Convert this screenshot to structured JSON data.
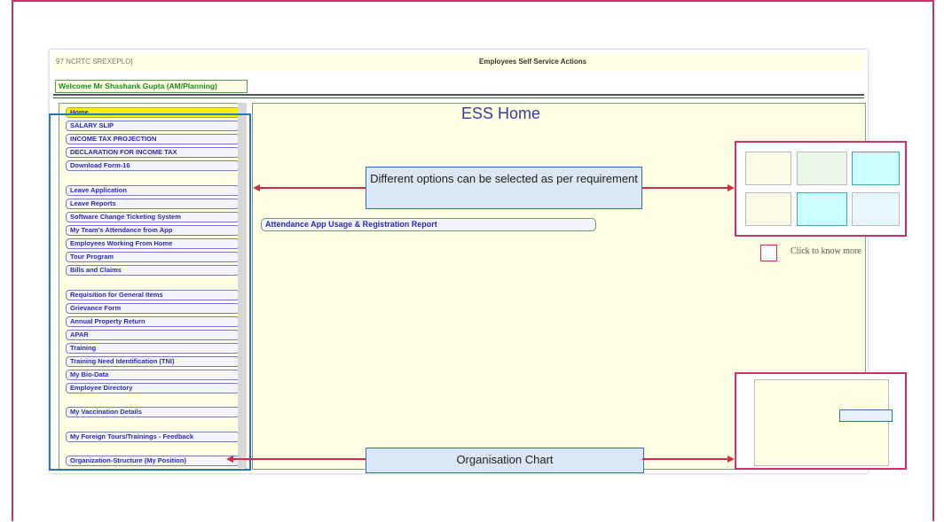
{
  "app": {
    "top_left_text": "97 NCRTC SREXEPLO]",
    "top_center_title": "Employees Self Service Actions",
    "welcome": "Welcome Mr Shashank Gupta (AM/Planning)"
  },
  "sidebar": {
    "items": [
      {
        "label": "Home"
      },
      {
        "label": "SALARY SLIP"
      },
      {
        "label": "INCOME TAX PROJECTION"
      },
      {
        "label": "DECLARATION FOR INCOME TAX"
      },
      {
        "label": "Download Form-16"
      },
      {
        "label": "Leave Application"
      },
      {
        "label": "Leave Reports"
      },
      {
        "label": "Software Change Ticketing System"
      },
      {
        "label": "My Team's Attendance from App"
      },
      {
        "label": "Employees Working From Home"
      },
      {
        "label": "Tour Program"
      },
      {
        "label": "Bills and Claims"
      },
      {
        "label": "Requisition for General Items"
      },
      {
        "label": "Grievance Form"
      },
      {
        "label": "Annual Property Return"
      },
      {
        "label": "APAR"
      },
      {
        "label": "Training"
      },
      {
        "label": "Training Need Identification (TNI)"
      },
      {
        "label": "My Bio-Data"
      },
      {
        "label": "Employee Directory"
      },
      {
        "label": "My Vaccination Details"
      },
      {
        "label": "My Foreign Tours/Trainings - Feedback"
      },
      {
        "label": "Organization-Structure (My Position)"
      }
    ]
  },
  "main": {
    "title": "ESS Home",
    "attendance_button": "Attendance App Usage & Registration Report"
  },
  "annotations": {
    "options_callout": "Different options can be selected as per requirement",
    "org_callout": "Organisation Chart",
    "click_more": "Click to know more"
  },
  "colors": {
    "frame": "#c8336b",
    "callout_border": "#2a74bf",
    "arrow": "#d42a4a",
    "home_highlight": "#ffee00"
  }
}
